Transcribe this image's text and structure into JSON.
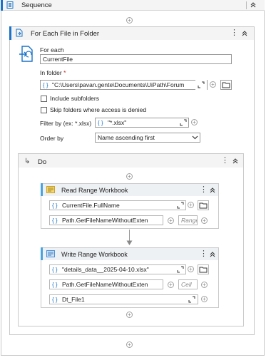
{
  "sequence": {
    "title": "Sequence"
  },
  "for_each": {
    "title": "For Each File in Folder",
    "for_each_label": "For each",
    "item_name": "CurrentFile",
    "in_folder_label": "In folder",
    "required_mark": "*",
    "folder_path": "\"C:\\Users\\pavan.gente\\Documents\\UiPath\\Forum",
    "include_subfolders_label": "Include subfolders",
    "skip_folders_label": "Skip folders where access is denied",
    "filter_label": "Filter by (ex: *.xlsx)",
    "filter_value": "\"*.xlsx\"",
    "order_by_label": "Order by",
    "order_by_value": "Name ascending first"
  },
  "do": {
    "title": "Do"
  },
  "read_range": {
    "title": "Read Range Workbook",
    "workbook_path": "CurrentFile.FullName",
    "sheet_name": "Path.GetFileNameWithoutExten",
    "range_placeholder": "Range"
  },
  "write_range": {
    "title": "Write Range Workbook",
    "workbook_path": "\"details_data__2025-04-10.xlsx\"",
    "sheet_name": "Path.GetFileNameWithoutExten",
    "cell_placeholder": "Cell",
    "datatable": "Dt_File1"
  },
  "colors": {
    "accent": "#1a73c8",
    "activity_accent": "#4aa3df",
    "header_bg": "#f4f4f4"
  }
}
